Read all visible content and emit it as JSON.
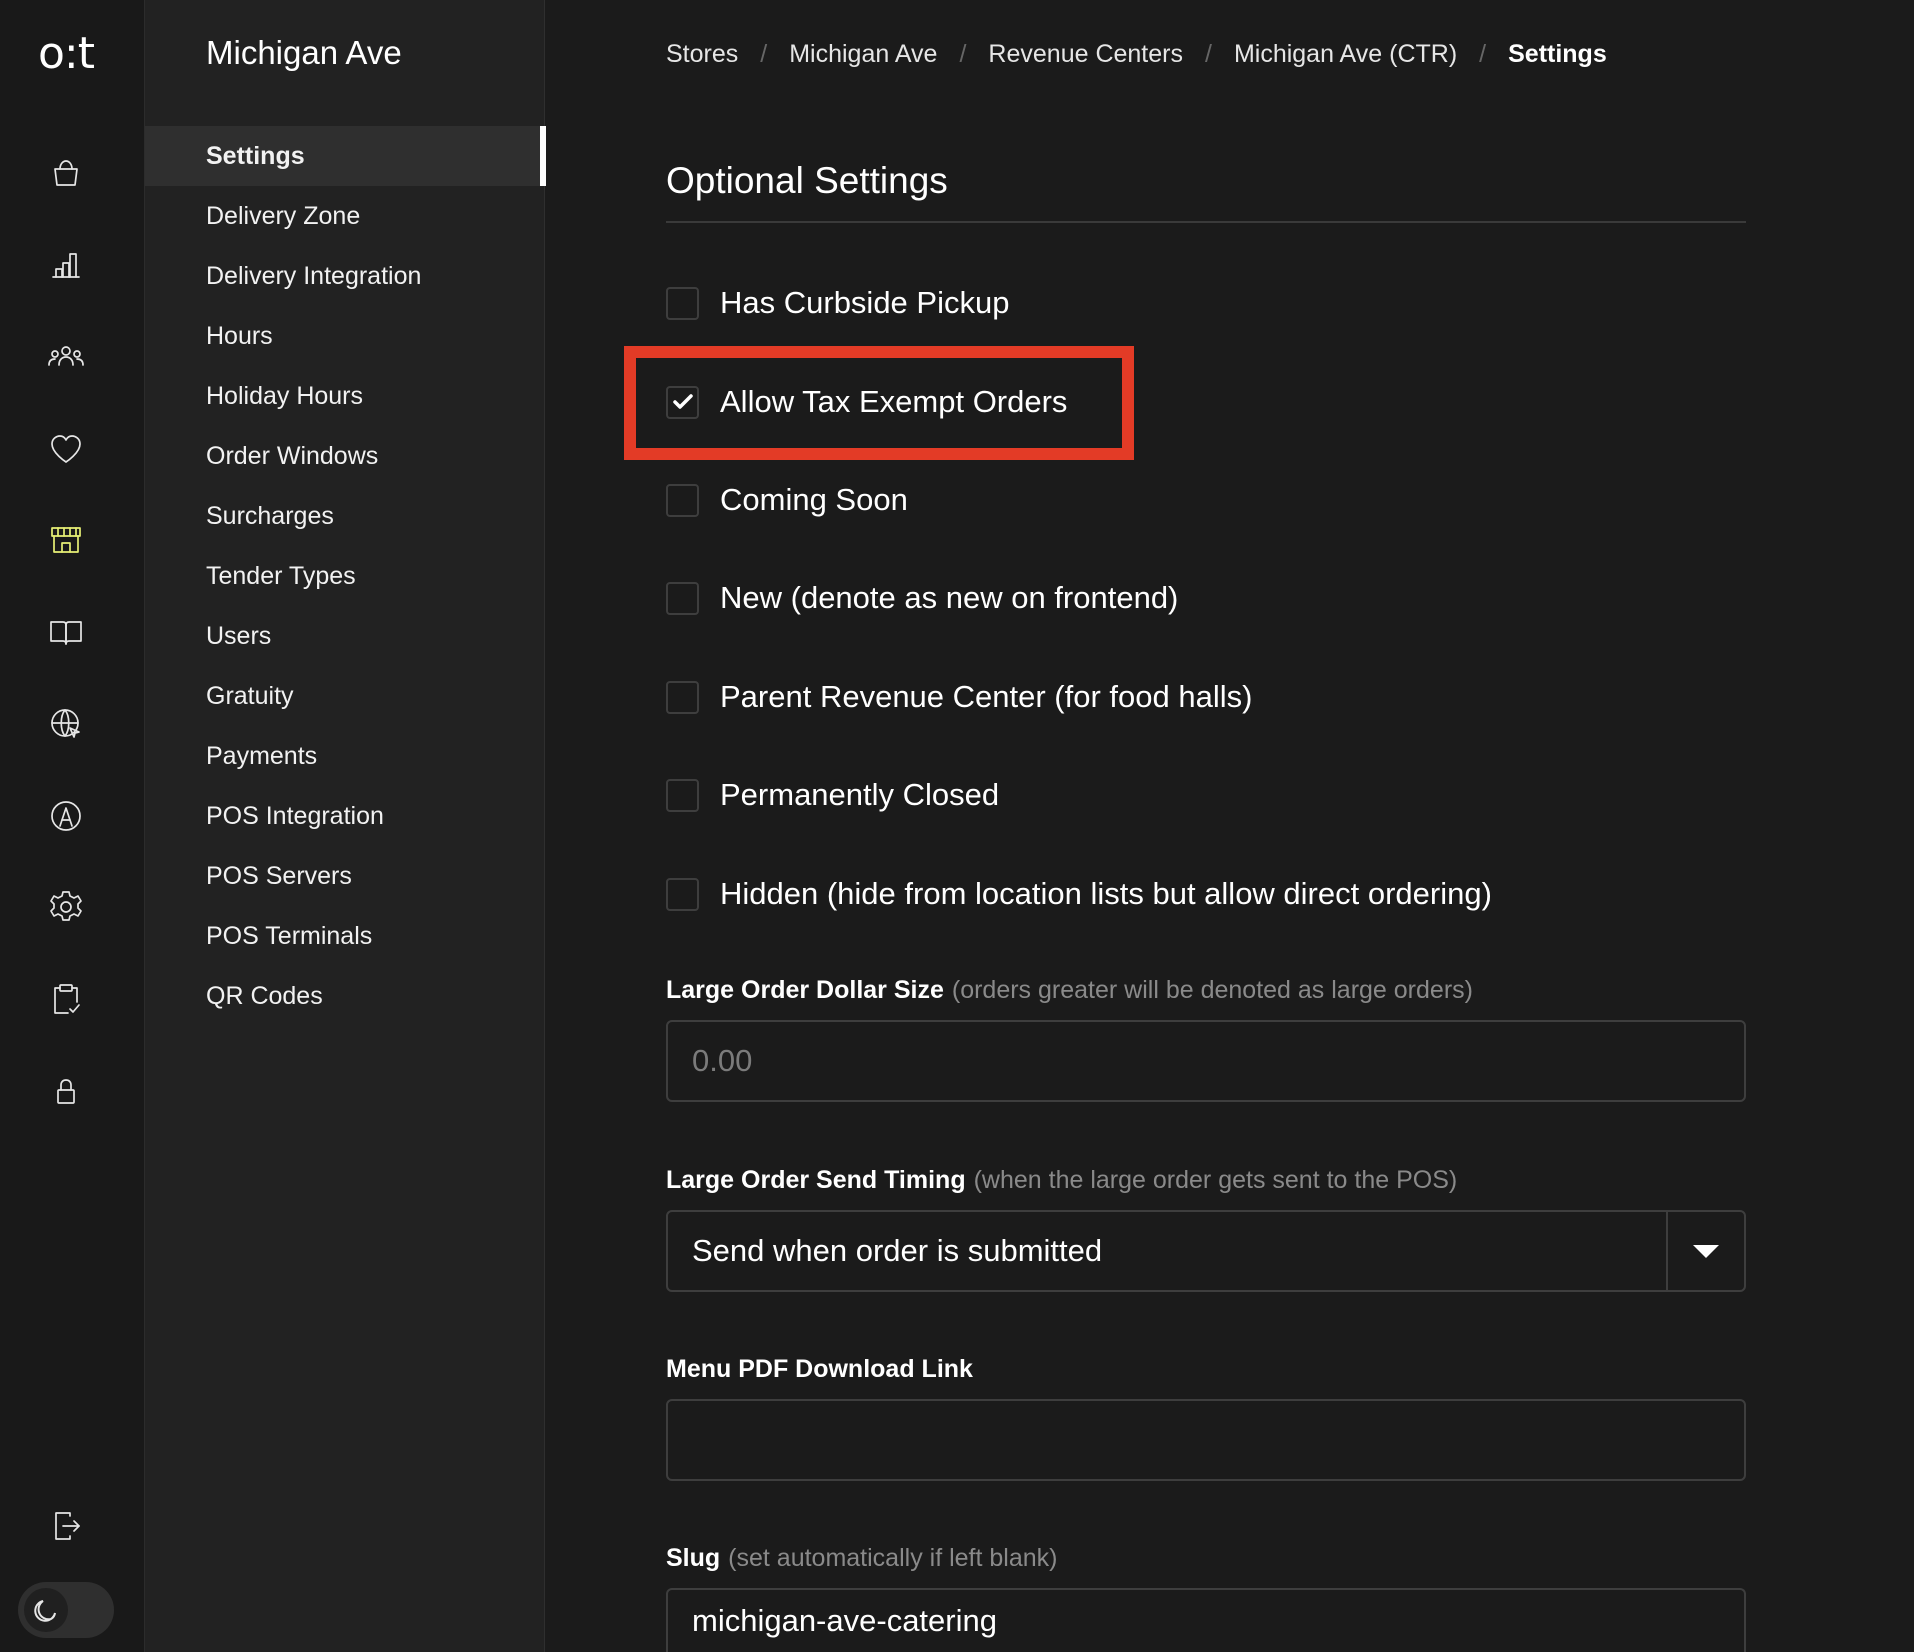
{
  "brand": {
    "logo": "o:t",
    "accent": "#e7f075",
    "highlight_color": "#e33b26"
  },
  "rail": {
    "icons": [
      "shopping-bag-icon",
      "bar-chart-icon",
      "users-icon",
      "heart-icon",
      "storefront-icon",
      "book-icon",
      "globe-icon",
      "compass-icon",
      "gear-icon",
      "clipboard-check-icon",
      "lock-icon"
    ],
    "active": "storefront-icon",
    "logout_icon": "logout-icon",
    "theme_toggle_icon": "moon-icon"
  },
  "subnav": {
    "title": "Michigan Ave",
    "items": [
      "Settings",
      "Delivery Zone",
      "Delivery Integration",
      "Hours",
      "Holiday Hours",
      "Order Windows",
      "Surcharges",
      "Tender Types",
      "Users",
      "Gratuity",
      "Payments",
      "POS Integration",
      "POS Servers",
      "POS Terminals",
      "QR Codes"
    ],
    "active": "Settings"
  },
  "breadcrumb": {
    "items": [
      "Stores",
      "Michigan Ave",
      "Revenue Centers",
      "Michigan Ave (CTR)",
      "Settings"
    ],
    "separator": "/"
  },
  "section": {
    "title": "Optional Settings"
  },
  "checkboxes": [
    {
      "label": "Has Curbside Pickup",
      "checked": false
    },
    {
      "label": "Allow Tax Exempt Orders",
      "checked": true
    },
    {
      "label": "Coming Soon",
      "checked": false
    },
    {
      "label": "New (denote as new on frontend)",
      "checked": false
    },
    {
      "label": "Parent Revenue Center (for food halls)",
      "checked": false
    },
    {
      "label": "Permanently Closed",
      "checked": false
    },
    {
      "label": "Hidden (hide from location lists but allow direct ordering)",
      "checked": false
    }
  ],
  "fields": {
    "large_order_size": {
      "label": "Large Order Dollar Size",
      "hint": "(orders greater will be denoted as large orders)",
      "value": "",
      "placeholder": "0.00"
    },
    "large_order_timing": {
      "label": "Large Order Send Timing",
      "hint": "(when the large order gets sent to the POS)",
      "value": "Send when order is submitted"
    },
    "menu_pdf": {
      "label": "Menu PDF Download Link",
      "value": "",
      "placeholder": ""
    },
    "slug": {
      "label": "Slug",
      "hint": "(set automatically if left blank)",
      "value": "michigan-ave-catering"
    }
  }
}
